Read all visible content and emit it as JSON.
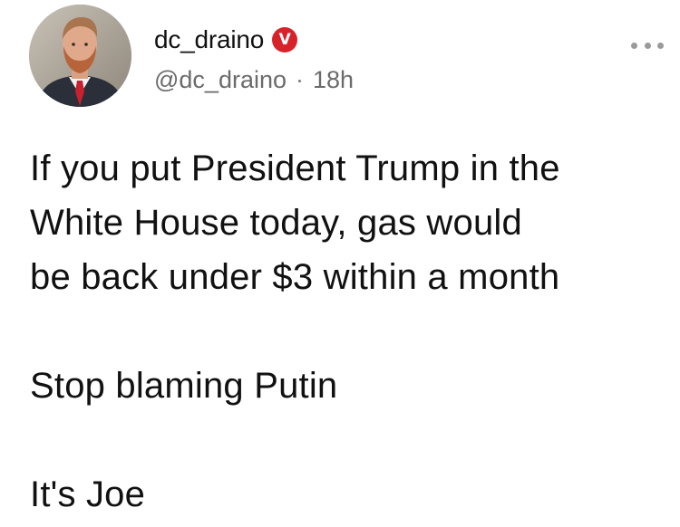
{
  "post": {
    "author": {
      "display_name": "dc_draino",
      "handle": "@dc_draino",
      "badge_text": "V",
      "badge_color": "#d8222a"
    },
    "separator": "·",
    "time_ago": "18h",
    "more_icon": "more-horizontal-icon",
    "body_lines": [
      "If you put President Trump in the",
      "White House today, gas would",
      "be back under $3 within a month",
      "",
      "Stop blaming Putin",
      "",
      "It's Joe"
    ]
  }
}
